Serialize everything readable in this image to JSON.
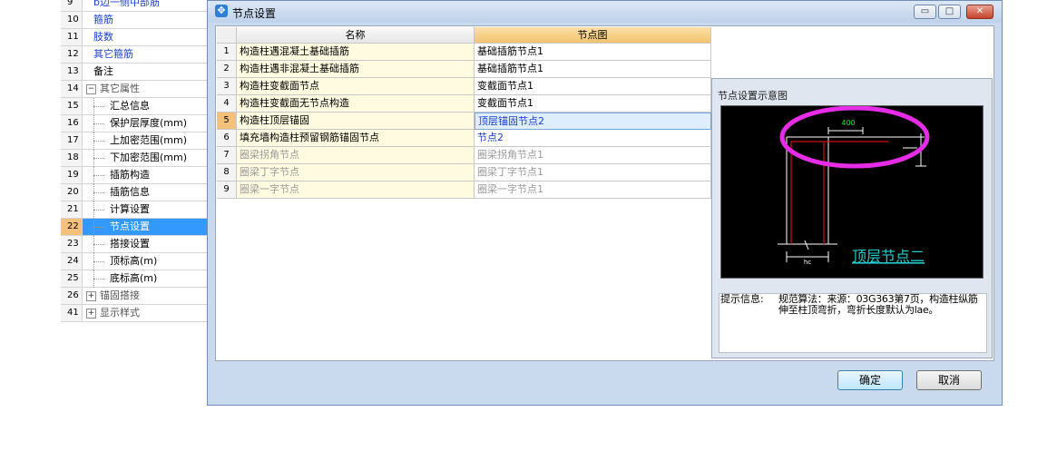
{
  "tree": {
    "rows": [
      {
        "num": "9",
        "label": "b边一侧中部筋",
        "color": "#1a3fcf",
        "indent": 1
      },
      {
        "num": "10",
        "label": "箍筋",
        "color": "#1a3fcf",
        "indent": 1
      },
      {
        "num": "11",
        "label": "肢数",
        "color": "#1a3fcf",
        "indent": 1
      },
      {
        "num": "12",
        "label": "其它箍筋",
        "color": "#1a3fcf",
        "indent": 1
      },
      {
        "num": "13",
        "label": "备注",
        "color": "#000000",
        "indent": 1
      },
      {
        "num": "14",
        "label": "其它属性",
        "color": "#555555",
        "indent": 0,
        "expander": "−"
      },
      {
        "num": "15",
        "label": "汇总信息",
        "color": "#000000",
        "indent": 2
      },
      {
        "num": "16",
        "label": "保护层厚度(mm)",
        "color": "#000000",
        "indent": 2
      },
      {
        "num": "17",
        "label": "上加密范围(mm)",
        "color": "#000000",
        "indent": 2
      },
      {
        "num": "18",
        "label": "下加密范围(mm)",
        "color": "#000000",
        "indent": 2
      },
      {
        "num": "19",
        "label": "插筋构造",
        "color": "#000000",
        "indent": 2
      },
      {
        "num": "20",
        "label": "插筋信息",
        "color": "#000000",
        "indent": 2
      },
      {
        "num": "21",
        "label": "计算设置",
        "color": "#000000",
        "indent": 2
      },
      {
        "num": "22",
        "label": "节点设置",
        "color": "#ffffff",
        "indent": 2,
        "selected": true
      },
      {
        "num": "23",
        "label": "搭接设置",
        "color": "#000000",
        "indent": 2
      },
      {
        "num": "24",
        "label": "顶标高(m)",
        "color": "#000000",
        "indent": 2
      },
      {
        "num": "25",
        "label": "底标高(m)",
        "color": "#000000",
        "indent": 2
      },
      {
        "num": "26",
        "label": "锚固搭接",
        "color": "#555555",
        "indent": 0,
        "expander": "+"
      },
      {
        "num": "41",
        "label": "显示样式",
        "color": "#555555",
        "indent": 0,
        "expander": "+"
      }
    ]
  },
  "dialog": {
    "title": "节点设置",
    "icon": "settings-app-icon",
    "window_buttons": {
      "minimize": "▭",
      "maximize": "□",
      "close": "✕"
    },
    "grid": {
      "headers": {
        "name": "名称",
        "node": "节点图"
      },
      "rows": [
        {
          "num": "1",
          "name": "构造柱遇混凝土基础插筋",
          "node": "基础插筋节点1",
          "style": ""
        },
        {
          "num": "2",
          "name": "构造柱遇非混凝土基础插筋",
          "node": "基础插筋节点1",
          "style": ""
        },
        {
          "num": "3",
          "name": "构造柱变截面节点",
          "node": "变截面节点1",
          "style": ""
        },
        {
          "num": "4",
          "name": "构造柱变截面无节点构造",
          "node": "变截面节点1",
          "style": ""
        },
        {
          "num": "5",
          "name": "构造柱顶层锚固",
          "node": "顶层锚固节点2",
          "style": "sel blue"
        },
        {
          "num": "6",
          "name": "填充墙构造柱预留钢筋锚固节点",
          "node": "节点2",
          "style": "blue"
        },
        {
          "num": "7",
          "name": "圈梁拐角节点",
          "node": "圈梁拐角节点1",
          "style": "gray"
        },
        {
          "num": "8",
          "name": "圈梁丁字节点",
          "node": "圈梁丁字节点1",
          "style": "gray"
        },
        {
          "num": "9",
          "name": "圈梁一字节点",
          "node": "圈梁一字节点1",
          "style": "gray"
        }
      ]
    },
    "preview": {
      "title": "节点设置示意图",
      "diagram": {
        "dimension_label": "400",
        "column_label": "hc",
        "caption": "顶层节点二",
        "highlight_color": "#e62ce6",
        "rebar_color": "#d01010",
        "line_color": "#ffffff",
        "dim_color": "#22dd22",
        "caption_color": "#22cccc"
      },
      "hint_label": "提示信息:",
      "hint_text": "规范算法：来源：03G363第7页，构造柱纵筋伸至柱顶弯折，弯折长度默认为lae。"
    },
    "buttons": {
      "ok": "确定",
      "cancel": "取消"
    }
  }
}
